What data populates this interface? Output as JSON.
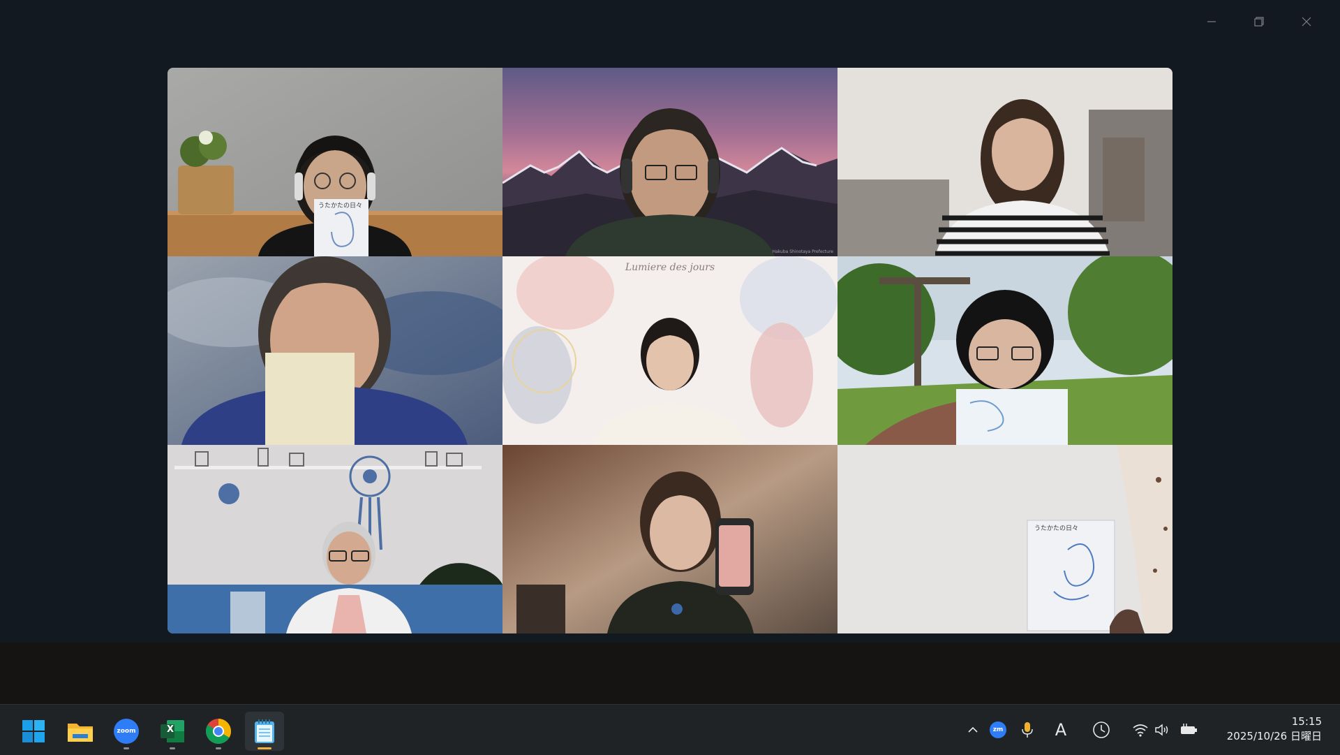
{
  "window": {
    "controls": {
      "minimize_icon": "minimize-icon",
      "restore_icon": "restore-icon",
      "close_icon": "close-icon"
    }
  },
  "gallery": {
    "active_speaker_color": "#2ed47a",
    "tiles": [
      {
        "id": "participant-1",
        "background": "gray-wall-plant",
        "book_title": "うたかたの日々"
      },
      {
        "id": "participant-2",
        "background": "mountain-sunset",
        "credit": "Hakuba Shinotaya Prefecture",
        "active": true
      },
      {
        "id": "participant-3",
        "background": "blurred-room"
      },
      {
        "id": "participant-4",
        "background": "blurred-blue"
      },
      {
        "id": "participant-5",
        "background": "watercolor-pastel",
        "watermark": "Lumiere des jours"
      },
      {
        "id": "participant-6",
        "background": "garden-pergola"
      },
      {
        "id": "participant-7",
        "background": "living-room-dreamcatcher"
      },
      {
        "id": "participant-8",
        "background": "warm-room"
      },
      {
        "id": "participant-9",
        "background": "white-wall",
        "book_title": "うたかたの日々"
      }
    ]
  },
  "taskbar": {
    "apps": [
      {
        "name": "start",
        "icon": "windows-logo-icon"
      },
      {
        "name": "file-explorer",
        "icon": "folder-icon"
      },
      {
        "name": "zoom",
        "icon": "zoom-icon",
        "label": "zoom"
      },
      {
        "name": "excel",
        "icon": "excel-icon",
        "label": "X"
      },
      {
        "name": "chrome",
        "icon": "chrome-icon"
      },
      {
        "name": "notepad",
        "icon": "notepad-icon"
      }
    ],
    "tray": {
      "zoom_tray_label": "zm",
      "ime_label": "A"
    },
    "clock": {
      "time": "15:15",
      "date": "2025/10/26 日曜日"
    }
  }
}
